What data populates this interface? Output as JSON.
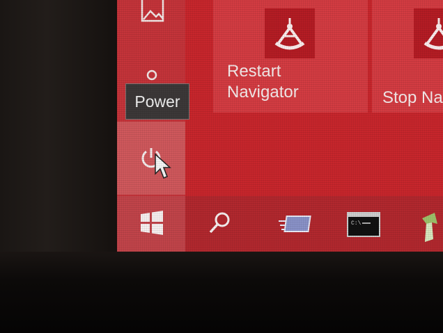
{
  "tooltip": {
    "text": "Power"
  },
  "tiles": [
    {
      "label_line1": "Restart",
      "label_line2": "Navigator"
    },
    {
      "label": "Stop Na"
    }
  ],
  "icons": {
    "pictures": "pictures-icon",
    "user": "user-icon",
    "power": "power-icon",
    "start": "windows-start-icon",
    "search": "search-icon",
    "task_view": "task-view-icon",
    "command_prompt": "command-prompt-icon",
    "app": "app-icon",
    "tile_glyph": "sextant-icon"
  },
  "colors": {
    "accent": "#c8262c",
    "tile": "#d43c42",
    "taskbar": "#b2282e",
    "tooltip_bg": "#3c3838"
  }
}
